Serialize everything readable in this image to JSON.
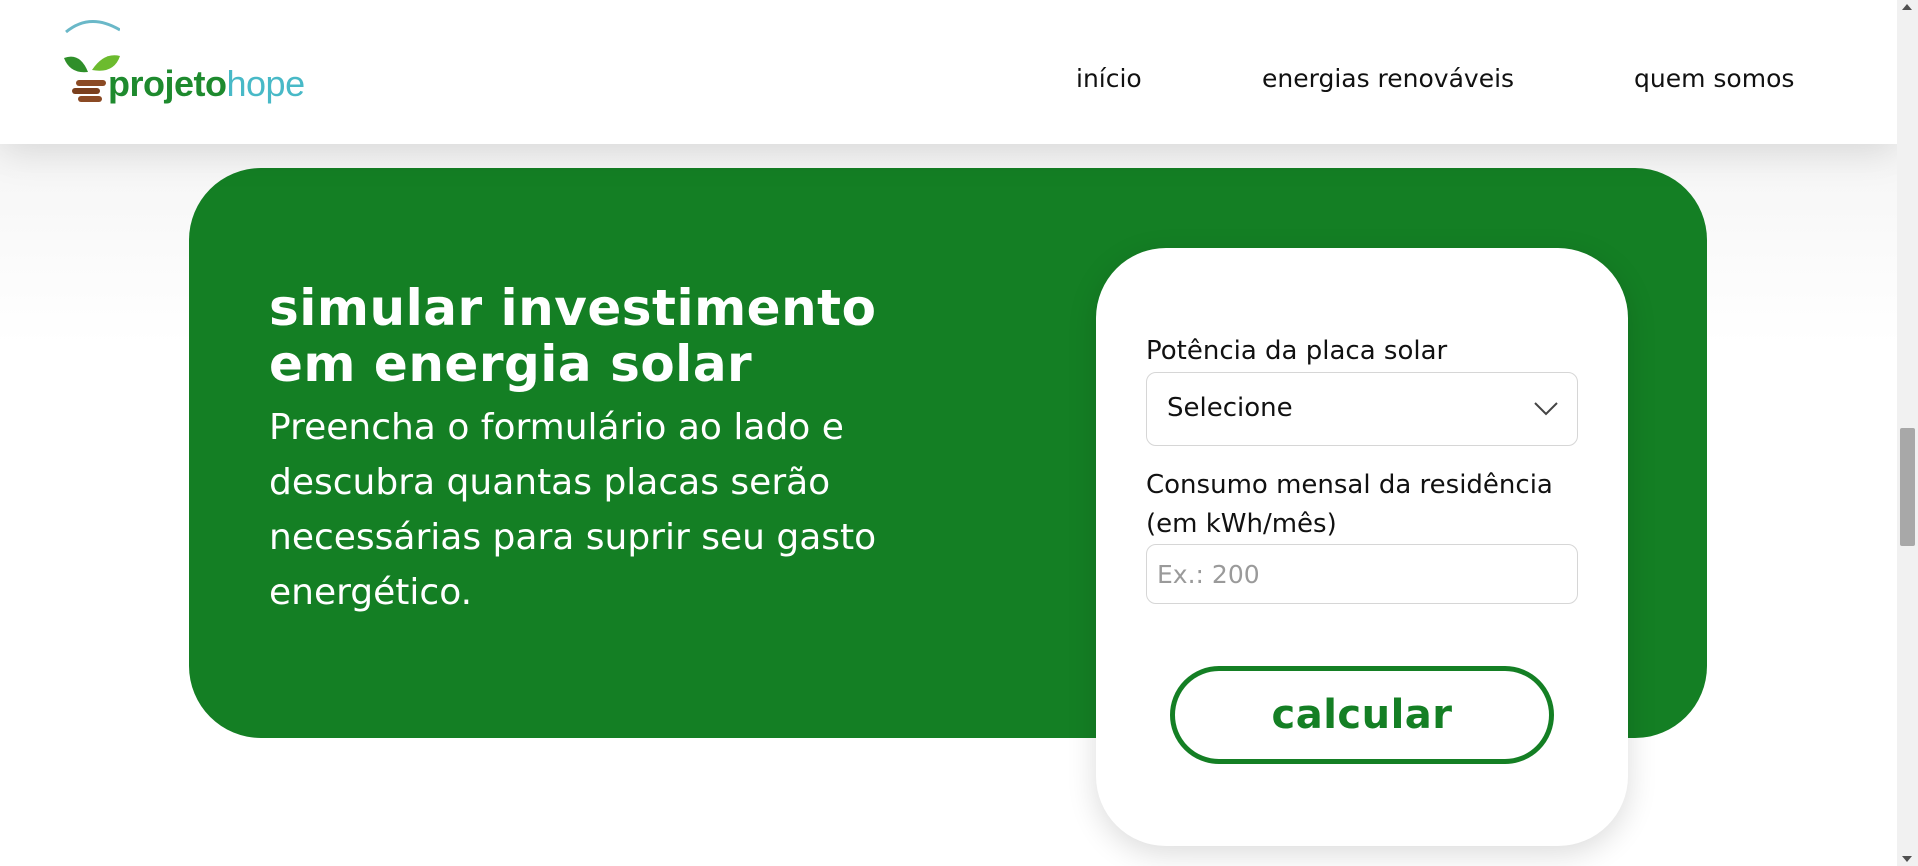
{
  "header": {
    "logo": {
      "strong_text": "projeto",
      "light_text": "hope",
      "icon": "sprout-logo-icon"
    },
    "nav": [
      {
        "label": "início"
      },
      {
        "label": "energias renováveis"
      },
      {
        "label": "quem somos"
      }
    ]
  },
  "banner": {
    "title": "simular investimento em energia solar",
    "description": "Preencha o formulário ao lado e descubra quantas placas serão necessárias para suprir seu gasto energético."
  },
  "form": {
    "power_label": "Potência da placa solar",
    "power_select_value": "Selecione",
    "consumption_label": "Consumo mensal da residência (em kWh/mês)",
    "consumption_placeholder": "Ex.: 200",
    "consumption_value": "",
    "submit_label": "calcular",
    "chevron_icon": "chevron-down-icon"
  },
  "colors": {
    "brand_green": "#147f24",
    "logo_green": "#1e8a2e",
    "logo_teal": "#48b9c7",
    "card_background": "#ffffff"
  }
}
